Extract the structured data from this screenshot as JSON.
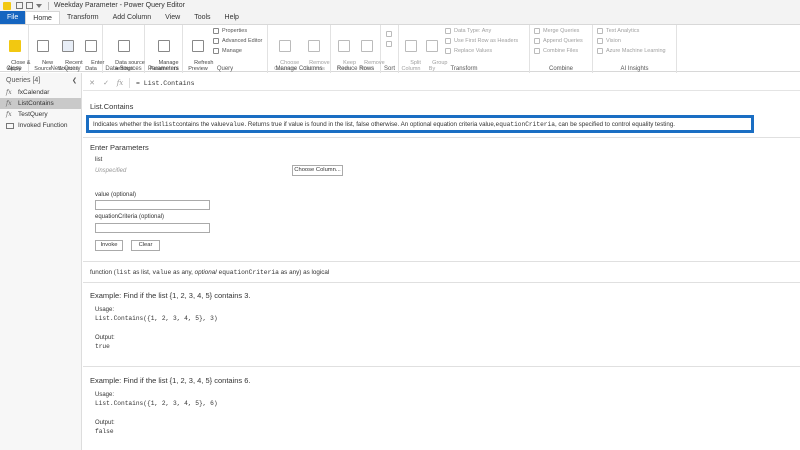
{
  "window": {
    "title": "Weekday Parameter - Power Query Editor"
  },
  "menu": {
    "tabs": [
      "File",
      "Home",
      "Transform",
      "Add Column",
      "View",
      "Tools",
      "Help"
    ]
  },
  "ribbon": {
    "close": {
      "label": "Close &\nApply",
      "group": "Close"
    },
    "new_query": {
      "new_source": "New\nSource",
      "recent_sources": "Recent\nSources",
      "enter_data": "Enter\nData",
      "group": "New Query"
    },
    "data_sources": {
      "settings": "Data source\nsettings",
      "group": "Data Sources"
    },
    "parameters": {
      "manage": "Manage\nParameters",
      "group": "Parameters"
    },
    "query": {
      "refresh": "Refresh\nPreview",
      "properties": "Properties",
      "advanced_editor": "Advanced Editor",
      "manage": "Manage",
      "group": "Query"
    },
    "manage_columns": {
      "choose": "Choose\nColumns",
      "remove": "Remove\nColumns",
      "group": "Manage Columns"
    },
    "reduce_rows": {
      "keep": "Keep\nRows",
      "remove": "Remove\nRows",
      "group": "Reduce Rows"
    },
    "sort": {
      "group": "Sort"
    },
    "transform": {
      "split": "Split\nColumn",
      "group_by": "Group\nBy",
      "data_type": "Data Type: Any",
      "first_row": "Use First Row as Headers",
      "replace": "Replace Values",
      "group": "Transform"
    },
    "combine": {
      "merge": "Merge Queries",
      "append": "Append Queries",
      "combine_files": "Combine Files",
      "group": "Combine"
    },
    "ai": {
      "text": "Text Analytics",
      "vision": "Vision",
      "aml": "Azure Machine Learning",
      "group": "AI Insights"
    }
  },
  "queries": {
    "header": "Queries [4]",
    "items": [
      {
        "label": "fxCalendar",
        "type": "fx"
      },
      {
        "label": "ListContains",
        "type": "fx"
      },
      {
        "label": "TestQuery",
        "type": "fx"
      },
      {
        "label": "Invoked Function",
        "type": "table"
      }
    ]
  },
  "formula": {
    "fx": "fx",
    "text": "= List.Contains"
  },
  "function": {
    "name": "List.Contains",
    "description_parts": [
      "Indicates whether the list ",
      "list",
      " contains the value ",
      "value",
      ". Returns true if value is found in the list, false otherwise. An optional equation criteria value, ",
      "equationCriteria",
      ", can be specified to control equality testing."
    ],
    "enter_params_title": "Enter Parameters",
    "params": {
      "list_label": "list",
      "list_value": "Unspecified",
      "choose_column": "Choose Column...",
      "value_label": "value (optional)",
      "eq_label": "equationCriteria (optional)"
    },
    "invoke": "Invoke",
    "clear": "Clear",
    "signature": {
      "prefix": "function (",
      "p1": "list",
      "t1": " as list, ",
      "p2": "value",
      "t2": " as any, ",
      "opt": "optional",
      "sp": " ",
      "p3": "equationCriteria",
      "t3": " as any) as logical"
    }
  },
  "examples": [
    {
      "title": "Example: Find if the list {1, 2, 3, 4, 5} contains 3.",
      "usage_label": "Usage:",
      "usage": "List.Contains({1, 2, 3, 4, 5}, 3)",
      "output_label": "Output:",
      "output": "true"
    },
    {
      "title": "Example: Find if the list {1, 2, 3, 4, 5} contains 6.",
      "usage_label": "Usage:",
      "usage": "List.Contains({1, 2, 3, 4, 5}, 6)",
      "output_label": "Output:",
      "output": "false"
    }
  ],
  "colors": {
    "accent": "#1a6ec3",
    "file_tab": "#1565c0",
    "selected_query": "#c9c9c9"
  }
}
